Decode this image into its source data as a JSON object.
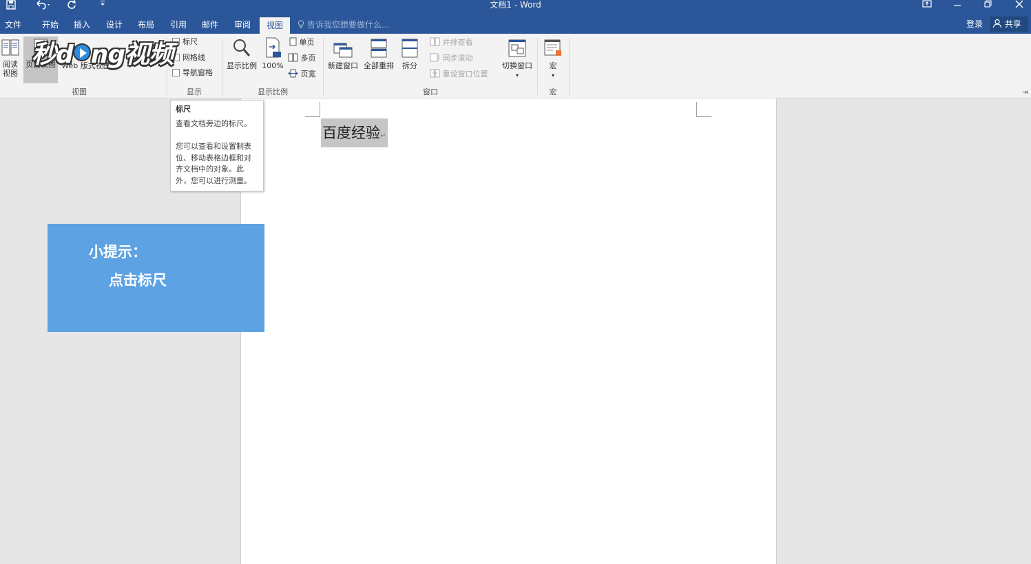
{
  "title_bar": {
    "title": "文档1 - Word",
    "qat": {
      "save_icon": "save-icon",
      "undo_icon": "undo-icon",
      "redo_icon": "redo-icon",
      "customize_icon": "customize-qat-icon"
    },
    "window_controls": [
      "ribbon-display-icon",
      "minimize-icon",
      "restore-icon",
      "close-icon"
    ]
  },
  "tabs": [
    {
      "label": "文件"
    },
    {
      "label": "开始"
    },
    {
      "label": "插入"
    },
    {
      "label": "设计"
    },
    {
      "label": "布局"
    },
    {
      "label": "引用"
    },
    {
      "label": "邮件"
    },
    {
      "label": "审阅"
    },
    {
      "label": "视图",
      "active": true
    }
  ],
  "tell_me": "告诉我您想要做什么...",
  "signin": "登录",
  "share": "共享",
  "ribbon": {
    "views": {
      "label": "视图",
      "read_line1": "阅读",
      "read_line2": "视图",
      "page_view": "页面视图",
      "web_view": "Web 版式视图"
    },
    "show": {
      "label": "显示",
      "ruler": "标尺",
      "gridlines": "网格线",
      "nav_pane": "导航窗格"
    },
    "zoom": {
      "label": "显示比例",
      "zoom": "显示比例",
      "hundred": "100%",
      "one_page": "单页",
      "multi_page": "多页",
      "page_width": "页宽"
    },
    "window": {
      "label": "窗口",
      "new_window": "新建窗口",
      "arrange_all": "全部重排",
      "split": "拆分",
      "side_by_side": "并排查看",
      "sync_scroll": "同步滚动",
      "reset_position": "重设窗口位置",
      "switch_windows": "切换窗口"
    },
    "macros": {
      "label": "宏",
      "macros": "宏"
    }
  },
  "watermark": {
    "text_a": "秒d",
    "text_b": "ng视频"
  },
  "document": {
    "text": "百度经验"
  },
  "tooltip": {
    "title": "标尺",
    "p1": "查看文档旁边的标尺。",
    "p2": "您可以查看和设置制表位、移动表格边框和对齐文档中的对象。此外，您可以进行测量。"
  },
  "hint": {
    "line1": "小提示：",
    "line2": "点击标尺"
  },
  "colors": {
    "accent": "#2b579a",
    "hint_bg": "#5da2e2",
    "ribbon_bg": "#f3f3f3",
    "canvas_bg": "#e6e6e6"
  }
}
